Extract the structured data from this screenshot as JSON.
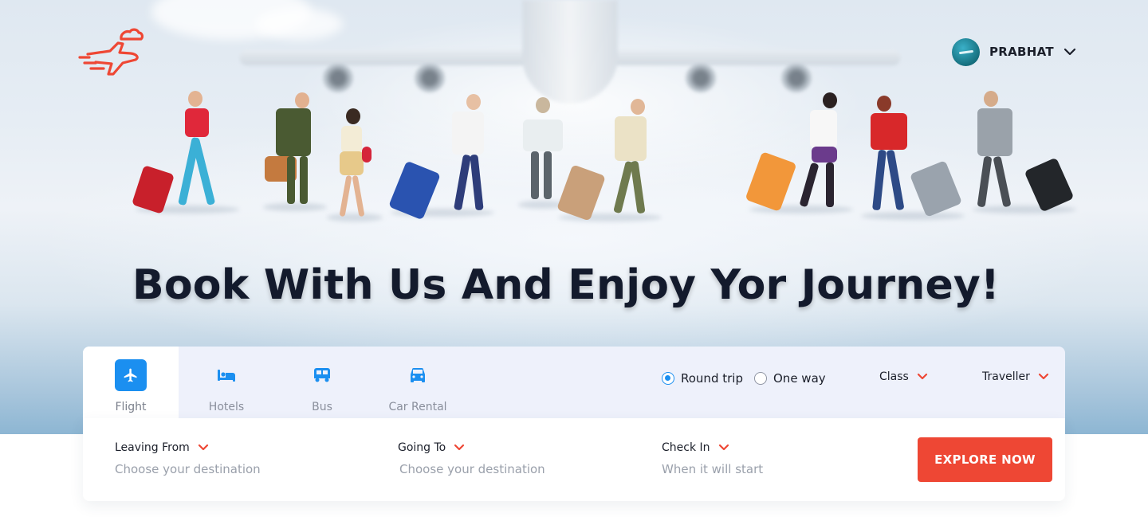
{
  "header": {
    "logo_icon": "plane-logo-icon",
    "user": {
      "name": "PRABHAT",
      "avatar_icon": "avatar-icon",
      "dropdown_icon": "chevron-down-icon"
    }
  },
  "hero": {
    "headline": "Book With Us And Enjoy Yor Journey!"
  },
  "booking": {
    "tabs": [
      {
        "label": "Flight",
        "icon": "plane-icon",
        "active": true
      },
      {
        "label": "Hotels",
        "icon": "bed-icon",
        "active": false
      },
      {
        "label": "Bus",
        "icon": "bus-icon",
        "active": false
      },
      {
        "label": "Car Rental",
        "icon": "car-icon",
        "active": false
      }
    ],
    "trip_type": {
      "options": [
        "Round trip",
        "One way"
      ],
      "selected": "Round trip"
    },
    "class_label": "Class",
    "traveller_label": "Traveller",
    "fields": [
      {
        "label": "Leaving From",
        "placeholder": "Choose your destination"
      },
      {
        "label": "Going To",
        "placeholder": "Choose your destination"
      },
      {
        "label": "Check In",
        "placeholder": "When it will start"
      }
    ],
    "explore_label": "EXPLORE NOW"
  },
  "colors": {
    "accent": "#ee4734",
    "primary_blue": "#1b8ff0",
    "headline": "#131a2c",
    "panel_bg": "#eef1fb"
  }
}
